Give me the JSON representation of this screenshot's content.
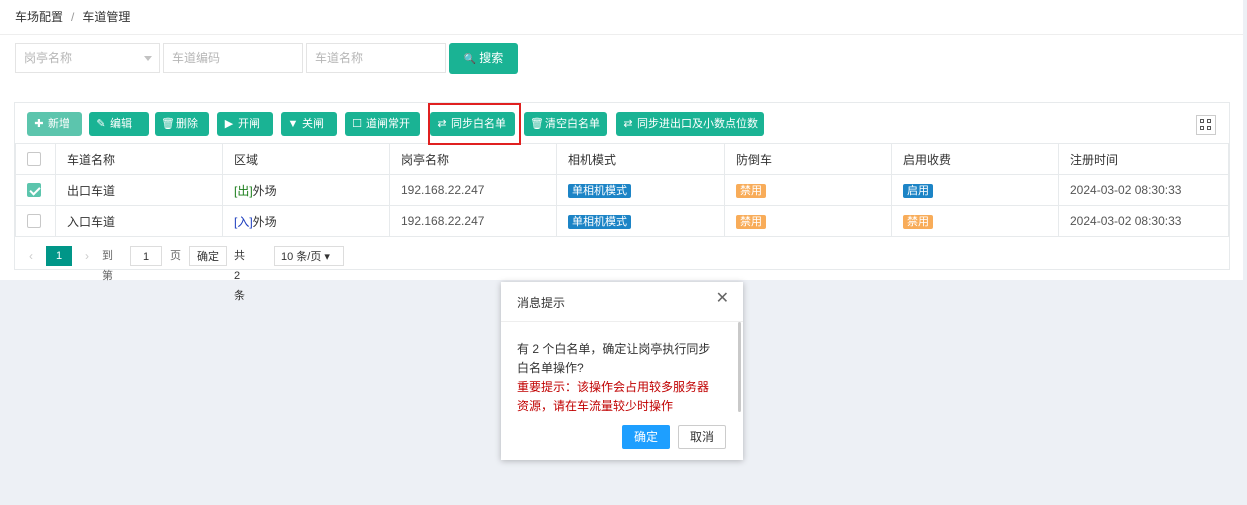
{
  "breadcrumb": {
    "parent": "车场配置",
    "separator": "/",
    "current": "车道管理"
  },
  "search": {
    "booth_placeholder": "岗亭名称",
    "lane_code_placeholder": "车道编码",
    "lane_name_placeholder": "车道名称",
    "search_label": "搜索",
    "search_icon": "🔍"
  },
  "toolbar": {
    "add": {
      "label": "新增",
      "icon": "✚"
    },
    "edit": {
      "label": "编辑",
      "icon": "✎"
    },
    "delete": {
      "label": "删除",
      "icon": "🗑"
    },
    "open": {
      "label": "开闸",
      "icon": "▶"
    },
    "close": {
      "label": "关闸",
      "icon": "▼"
    },
    "normally_open": {
      "label": "道闸常开",
      "icon": "☐"
    },
    "sync_whitelist": {
      "label": "同步白名单",
      "icon": "⇄"
    },
    "clear_whitelist": {
      "label": "清空白名单",
      "icon": "🗑"
    },
    "sync_exit_decimal": {
      "label": "同步进出口及小数点位数",
      "icon": "⇄"
    }
  },
  "table": {
    "headers": [
      "车道名称",
      "区域",
      "岗亭名称",
      "相机模式",
      "防倒车",
      "启用收费",
      "注册时间"
    ],
    "rows": [
      {
        "checked": true,
        "name": "出口车道",
        "area_tag": "[出]",
        "area_name": "外场",
        "booth": "192.168.22.247",
        "camera": "单相机模式",
        "anti_reverse": "禁用",
        "charging": "启用",
        "time": "2024-03-02 08:30:33"
      },
      {
        "checked": false,
        "name": "入口车道",
        "area_tag": "[入]",
        "area_name": "外场",
        "booth": "192.168.22.247",
        "camera": "单相机模式",
        "anti_reverse": "禁用",
        "charging": "禁用",
        "time": "2024-03-02 08:30:33"
      }
    ]
  },
  "pager": {
    "prev": "‹",
    "current": "1",
    "next": "›",
    "goto_label": "到第",
    "goto_value": "1",
    "page_unit": "页",
    "confirm": "确定",
    "total": "共 2 条",
    "page_size": "10 条/页 ▾"
  },
  "dialog": {
    "title": "消息提示",
    "close": "✕",
    "message": "有 2 个白名单，确定让岗亭执行同步白名单操作?",
    "warning": "重要提示：该操作会占用较多服务器资源，请在车流量较少时操作",
    "ok": "确定",
    "cancel": "取消"
  },
  "colors": {
    "primary": "#1ab394",
    "dialog_ok": "#1e9fff",
    "highlight": "#e02020",
    "warning": "#c00000"
  }
}
